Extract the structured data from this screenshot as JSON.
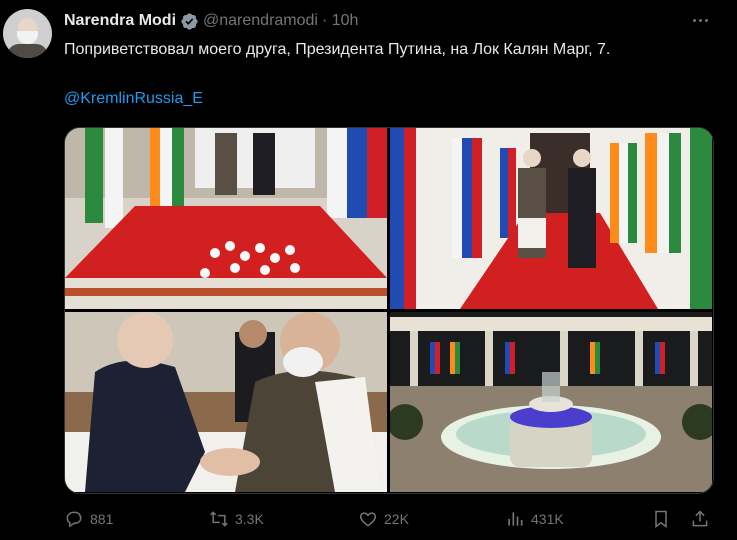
{
  "tweet": {
    "author_name": "Narendra Modi",
    "handle": "@narendramodi",
    "time": "· 10h",
    "text": "Поприветствовал моего друга, Президента Путина, на Лок Калян Марг, 7.",
    "mention": "@KremlinRussia_E"
  },
  "metrics": {
    "replies": "881",
    "reposts": "3.3K",
    "likes": "22K",
    "views": "431K"
  },
  "colors": {
    "accent": "#1d9bf0",
    "muted": "#71767b",
    "text": "#e7e9ea",
    "carpet": "#d21f1f"
  },
  "icons": [
    "verified-badge-icon",
    "more-icon",
    "reply-icon",
    "repost-icon",
    "like-icon",
    "views-icon",
    "bookmark-icon",
    "share-icon"
  ]
}
